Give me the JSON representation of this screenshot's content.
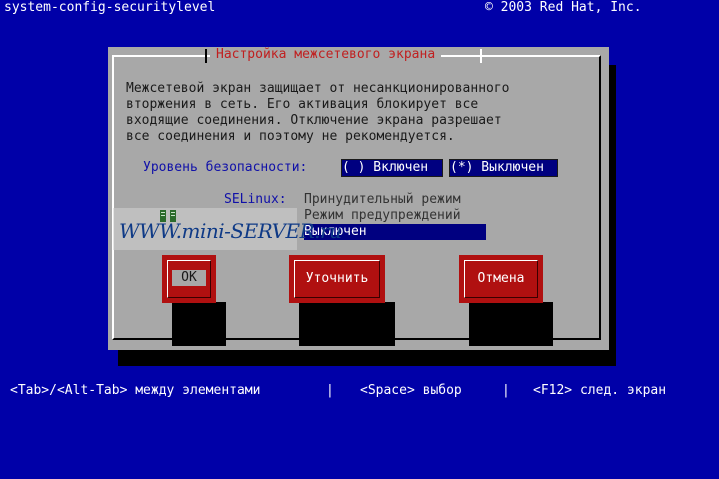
{
  "header": {
    "app_name": "system-config-securitylevel",
    "copyright": "© 2003 Red Hat, Inc."
  },
  "dialog": {
    "title": "Настройка межсетевого экрана",
    "description": "Межсетевой экран защищает от несанкционированного\nвторжения в сеть. Его активация блокирует все\nвходящие соединения. Отключение экрана разрешает\nвсе соединения и поэтому не рекомендуется.",
    "security_label": "Уровень безопасности:",
    "security_options": [
      {
        "label": "( ) Включен",
        "selected": false
      },
      {
        "label": "(*) Выключен",
        "selected": true
      }
    ],
    "selinux_label": "SELinux:",
    "selinux_options": [
      {
        "label": "Принудительный режим",
        "selected": false
      },
      {
        "label": "Режим предупреждений",
        "selected": false
      },
      {
        "label": "Выключен",
        "selected": true
      }
    ],
    "buttons": {
      "ok": "OK",
      "customize": "Уточнить",
      "cancel": "Отмена"
    }
  },
  "footer": {
    "hint_nav": "<Tab>/<Alt-Tab> между элементами",
    "separator": "|",
    "hint_space": "<Space> выбор",
    "hint_f12": "<F12> след. экран"
  },
  "watermark": {
    "text": "WWW.mini-SERVER.ru"
  },
  "colors": {
    "background": "#0000a8",
    "dialog": "#a8a8a8",
    "title": "#c02020",
    "button": "#b01010",
    "highlight": "#000080"
  }
}
